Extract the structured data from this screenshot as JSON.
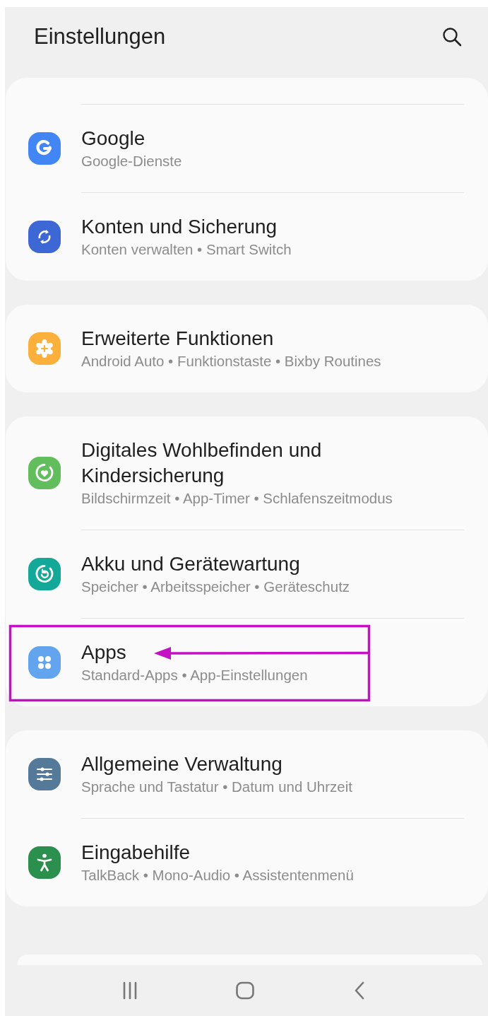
{
  "header": {
    "title": "Einstellungen"
  },
  "groups": [
    {
      "items": [
        {
          "title": "Google",
          "subtitle": "Google-Dienste",
          "kind": "google",
          "color": "#4285f4",
          "highlighted": false
        },
        {
          "title": "Konten und Sicherung",
          "subtitle": "Konten verwalten • Smart Switch",
          "kind": "sync",
          "color": "#3e67d6",
          "highlighted": false
        }
      ]
    },
    {
      "items": [
        {
          "title": "Erweiterte Funktionen",
          "subtitle": "Android Auto • Funktionstaste • Bixby Routines",
          "kind": "gear-plus",
          "color": "#fbb03b",
          "highlighted": false
        }
      ]
    },
    {
      "items": [
        {
          "title": "Digitales Wohlbefinden und Kindersicherung",
          "subtitle": "Bildschirmzeit • App-Timer • Schlafenszeitmodus",
          "kind": "heart-ring",
          "color": "#62bd5c",
          "highlighted": false
        },
        {
          "title": "Akku und Gerätewartung",
          "subtitle": "Speicher • Arbeitsspeicher • Geräteschutz",
          "kind": "care-ring",
          "color": "#13a898",
          "highlighted": false
        },
        {
          "title": "Apps",
          "subtitle": "Standard-Apps • App-Einstellungen",
          "kind": "apps",
          "color": "#62a4ee",
          "highlighted": true
        }
      ]
    },
    {
      "items": [
        {
          "title": "Allgemeine Verwaltung",
          "subtitle": "Sprache und Tastatur • Datum und Uhrzeit",
          "kind": "sliders",
          "color": "#557a99",
          "highlighted": false
        },
        {
          "title": "Eingabehilfe",
          "subtitle": "TalkBack • Mono-Audio • Assistentenmenü",
          "kind": "person",
          "color": "#2b8f4e",
          "highlighted": false
        }
      ]
    }
  ]
}
